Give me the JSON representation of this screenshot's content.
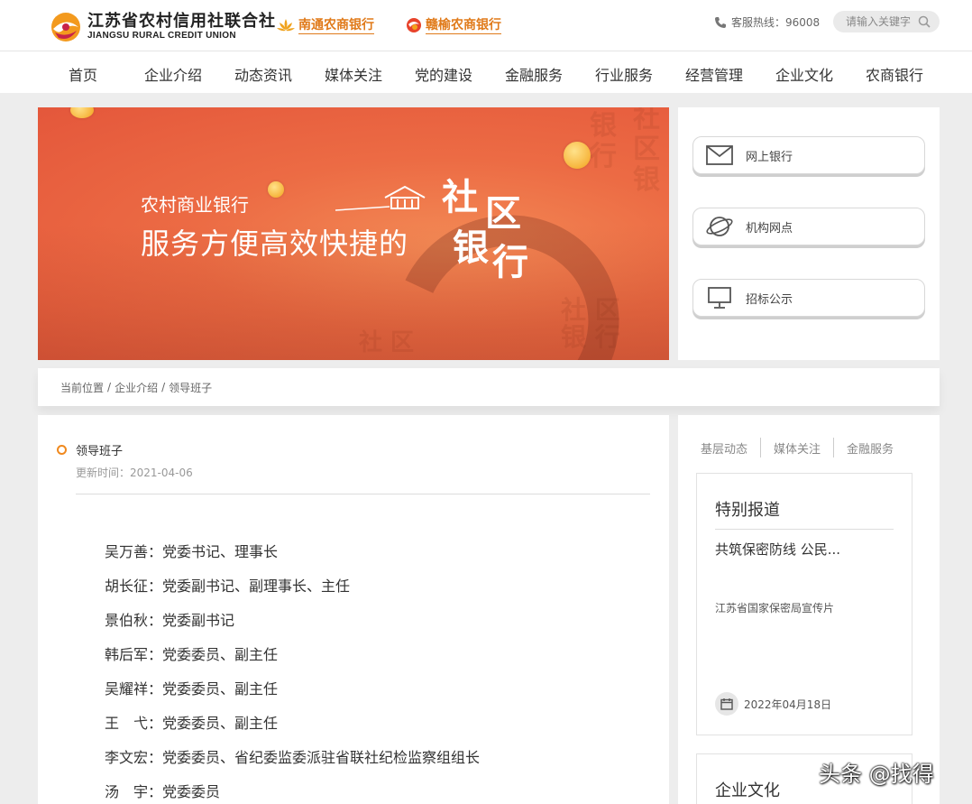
{
  "header": {
    "logo_cn": "江苏省农村信用社联合社",
    "logo_en": "JIANGSU RURAL CREDIT UNION",
    "partners": [
      "南通农商银行",
      "赣榆农商银行"
    ],
    "hotline": "客服热线：96008",
    "search_placeholder": "请输入关键字"
  },
  "nav": [
    "首页",
    "企业介绍",
    "动态资讯",
    "媒体关注",
    "党的建设",
    "金融服务",
    "行业服务",
    "经营管理",
    "企业文化",
    "农商银行"
  ],
  "banner": {
    "subtitle": "农村商业银行",
    "title": "服务方便高效快捷的",
    "calligraphy": [
      "社",
      "区",
      "银",
      "行"
    ]
  },
  "quick_links": [
    {
      "label": "网上银行",
      "icon": "mail-icon"
    },
    {
      "label": "机构网点",
      "icon": "globe-icon"
    },
    {
      "label": "招标公示",
      "icon": "monitor-icon"
    }
  ],
  "breadcrumb": [
    "当前位置",
    "企业介绍",
    "领导班子"
  ],
  "article": {
    "title": "领导班子",
    "updated": "更新时间：2021-04-06",
    "leaders": [
      "吴万善：党委书记、理事长",
      "胡长征：党委副书记、副理事长、主任",
      "景伯秋：党委副书记",
      "韩后军：党委委员、副主任",
      "吴耀祥：党委委员、副主任",
      "王　弋：党委委员、副主任",
      "李文宏：党委委员、省纪委监委派驻省联社纪检监察组组长",
      "汤　宇：党委委员"
    ]
  },
  "sidebar": {
    "tabs": [
      "基层动态",
      "媒体关注",
      "金融服务"
    ],
    "special": {
      "heading": "特别报道",
      "news_title": "共筑保密防线 公民...",
      "desc": "江苏省国家保密局宣传片",
      "date": "2022年04月18日"
    },
    "culture_heading": "企业文化"
  },
  "watermark": "头条 @找得",
  "colors": {
    "accent": "#e07a1a",
    "banner": "#ec6b44"
  }
}
